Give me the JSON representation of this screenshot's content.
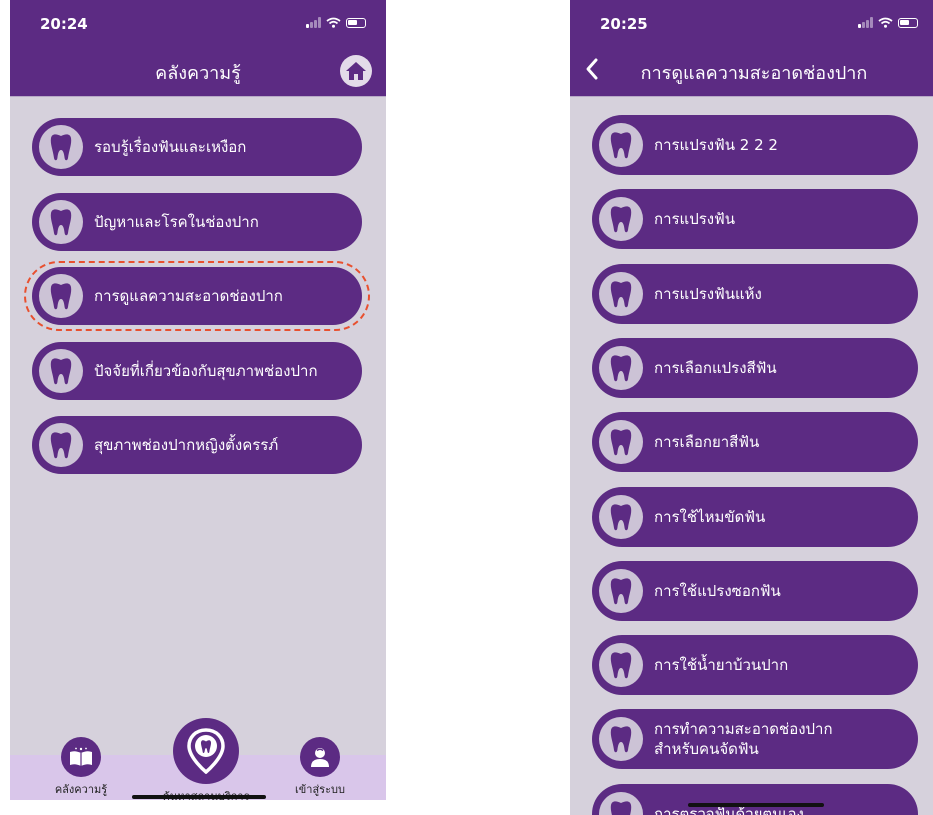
{
  "left_screen": {
    "status_time": "20:24",
    "nav_title": "คลังความรู้",
    "menu": [
      {
        "label": "รอบรู้เรื่องฟันและเหงือก"
      },
      {
        "label": "ปัญหาและโรคในช่องปาก"
      },
      {
        "label": "การดูแลความสะอาดช่องปาก"
      },
      {
        "label": "ปัจจัยที่เกี่ยวข้องกับสุขภาพช่องปาก"
      },
      {
        "label": "สุขภาพช่องปากหญิงตั้งครรภ์"
      }
    ],
    "tabs": {
      "knowledge": "คลังความรู้",
      "find_service": "ค้นหาสถานบริการ",
      "login": "เข้าสู่ระบบ"
    }
  },
  "right_screen": {
    "status_time": "20:25",
    "nav_title": "การดูแลความสะอาดช่องปาก",
    "menu": [
      {
        "label": "การแปรงฟัน 2 2 2"
      },
      {
        "label": "การแปรงฟัน"
      },
      {
        "label": "การแปรงฟันแห้ง"
      },
      {
        "label": "การเลือกแปรงสีฟัน"
      },
      {
        "label": "การเลือกยาสีฟัน"
      },
      {
        "label": "การใช้ไหมขัดฟัน"
      },
      {
        "label": "การใช้แปรงซอกฟัน"
      },
      {
        "label": "การใช้น้ำยาบ้วนปาก"
      },
      {
        "label": "การทำความสะอาดช่องปาก",
        "label2": "สำหรับคนจัดฟัน"
      },
      {
        "label": "การตรวจฟันด้วยตนเอง"
      }
    ]
  },
  "colors": {
    "primary": "#5c2b83",
    "background": "#d6d1dc",
    "icon_circle": "#ccc3d6",
    "tabbar": "#d9c6ea",
    "highlight": "#e8502f"
  },
  "icons": {
    "menu_item": "tooth-icon",
    "home": "home-icon",
    "back": "chevron-left-icon",
    "tab_knowledge": "book-icon",
    "tab_find_service": "map-pin-tooth-icon",
    "tab_login": "user-icon"
  }
}
